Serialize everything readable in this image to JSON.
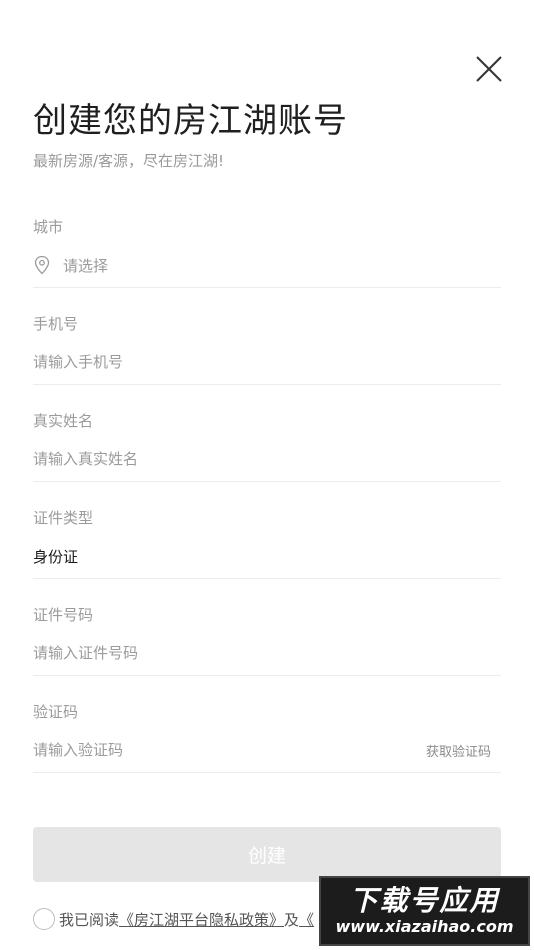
{
  "header": {
    "title": "创建您的房江湖账号",
    "subtitle": "最新房源/客源，尽在房江湖!",
    "close_icon": "close-icon"
  },
  "form": {
    "city": {
      "label": "城市",
      "placeholder": "请选择",
      "icon": "location-pin-icon"
    },
    "phone": {
      "label": "手机号",
      "placeholder": "请输入手机号"
    },
    "real_name": {
      "label": "真实姓名",
      "placeholder": "请输入真实姓名"
    },
    "id_type": {
      "label": "证件类型",
      "value": "身份证"
    },
    "id_number": {
      "label": "证件号码",
      "placeholder": "请输入证件号码"
    },
    "verify_code": {
      "label": "验证码",
      "placeholder": "请输入验证码",
      "get_code_label": "获取验证码"
    }
  },
  "actions": {
    "create_label": "创建",
    "create_bg": "#e5e5e5"
  },
  "agreement": {
    "prefix": "我已阅读",
    "privacy_link": "《房江湖平台隐私政策》",
    "conjunction": "及",
    "second_link_partial": "《"
  },
  "watermark": {
    "main": "下载号应用",
    "url": "www.xiazaihao.com"
  }
}
